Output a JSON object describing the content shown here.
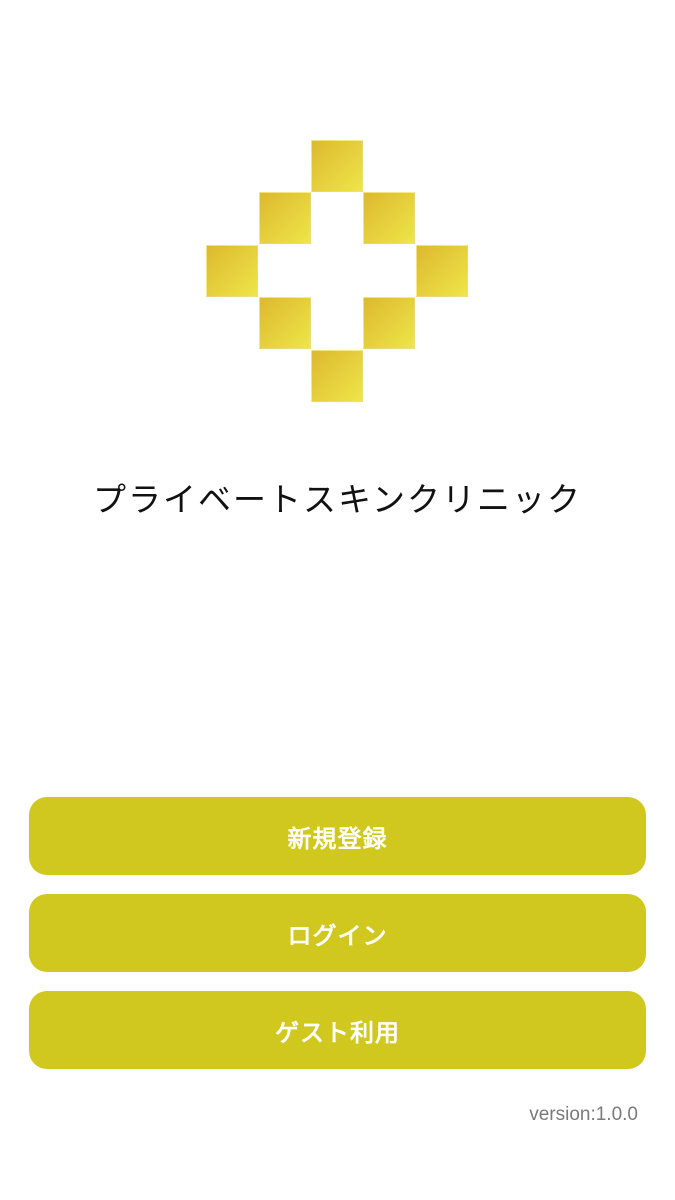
{
  "app": {
    "name": "プライベートスキンクリニック"
  },
  "logo": {
    "icon": "clinic-diamond-logo-icon",
    "colors": {
      "dark": "#DDB92E",
      "light": "#EEE549"
    }
  },
  "buttons": {
    "color": "#D0C81E",
    "register_label": "新規登録",
    "login_label": "ログイン",
    "guest_label": "ゲスト利用"
  },
  "footer": {
    "version_text": "version:1.0.0"
  }
}
